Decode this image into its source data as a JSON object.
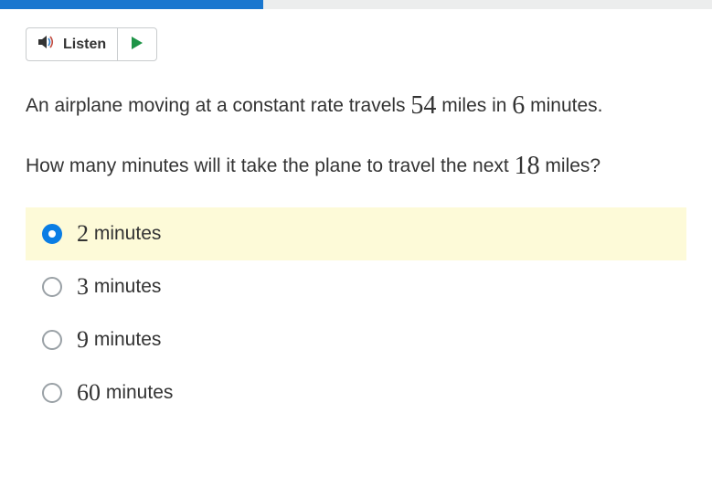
{
  "progress": {
    "percent": 37
  },
  "toolbar": {
    "listen_label": "Listen"
  },
  "question": {
    "part1_pre": "An airplane moving at a constant rate travels ",
    "num1": "54",
    "part1_mid": " miles in ",
    "num2": "6",
    "part1_post": " minutes.",
    "part2_pre": "How many minutes will it take the plane to travel the next ",
    "num3": "18",
    "part2_post": " miles?"
  },
  "options": [
    {
      "value": "2",
      "unit": "minutes",
      "selected": true
    },
    {
      "value": "3",
      "unit": "minutes",
      "selected": false
    },
    {
      "value": "9",
      "unit": "minutes",
      "selected": false
    },
    {
      "value": "60",
      "unit": "minutes",
      "selected": false
    }
  ]
}
